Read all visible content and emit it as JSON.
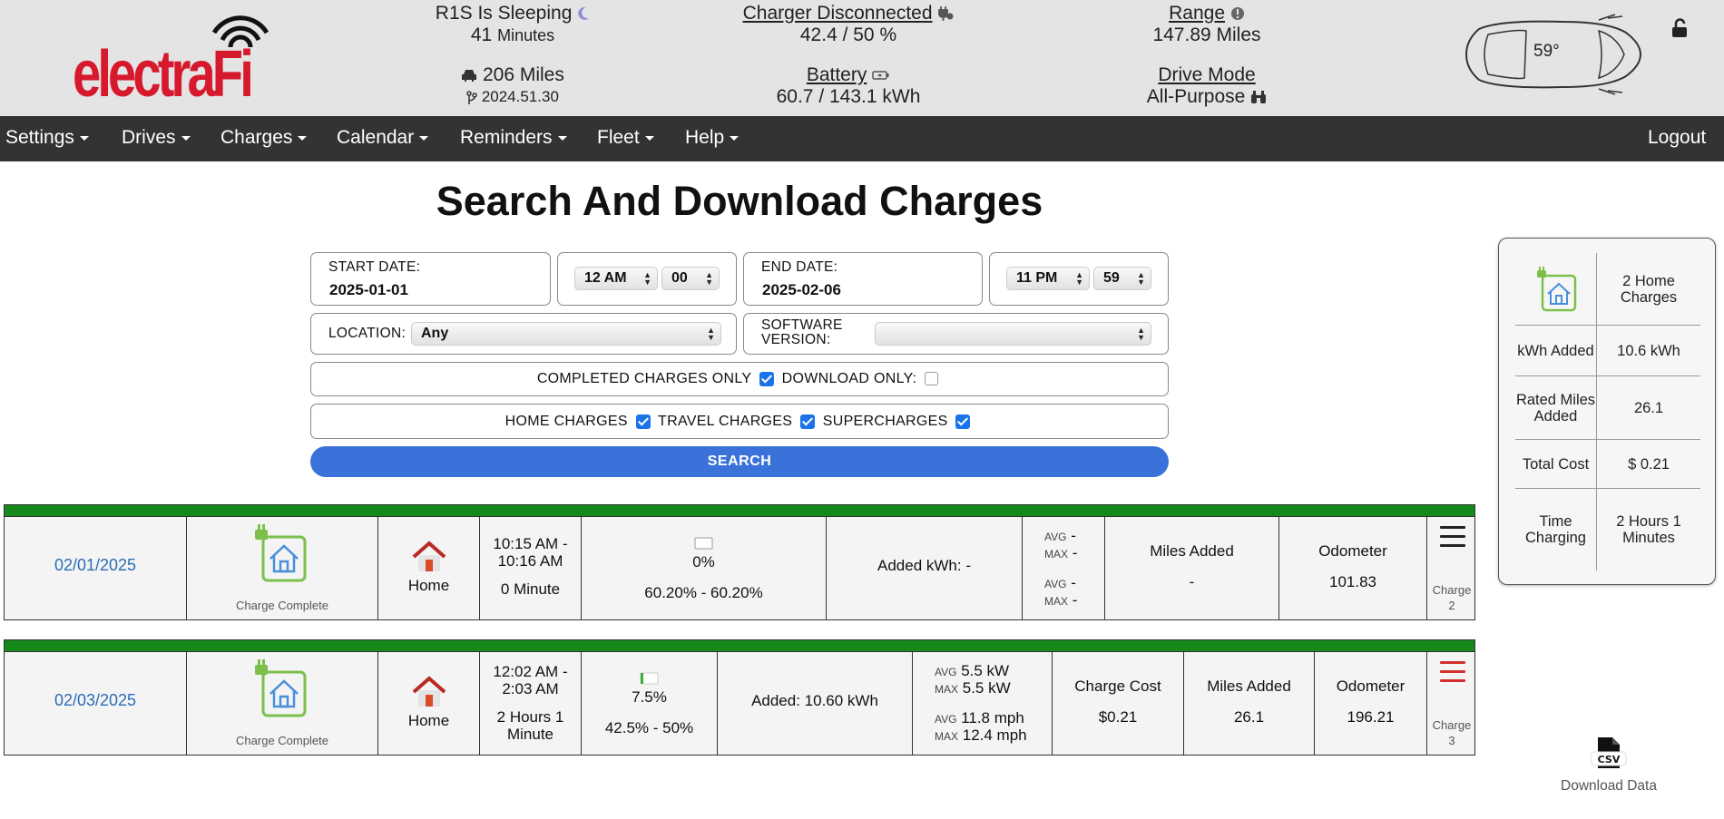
{
  "header": {
    "logo_text": "electraFi",
    "sleep_status": "R1S Is Sleeping",
    "sleep_time_value": "41",
    "sleep_time_unit": "Minutes",
    "odometer_miles": "206 Miles",
    "software_version": "2024.51.30",
    "charger_status": "Charger Disconnected",
    "charge_level": "42.4 / 50 %",
    "battery_label": "Battery",
    "battery_value": "60.7 / 143.1 kWh",
    "range_label": "Range",
    "range_value": "147.89 Miles",
    "drive_mode_label": "Drive Mode",
    "drive_mode_value": "All-Purpose",
    "temperature": "59°"
  },
  "nav": {
    "items": [
      "Settings",
      "Drives",
      "Charges",
      "Calendar",
      "Reminders",
      "Fleet",
      "Help"
    ],
    "logout": "Logout"
  },
  "page_title": "Search And Download Charges",
  "form": {
    "start_label": "START DATE:",
    "start_value": "2025-01-01",
    "start_hour": "12 AM",
    "start_minute": "00",
    "end_label": "END DATE:",
    "end_value": "2025-02-06",
    "end_hour": "11 PM",
    "end_minute": "59",
    "location_label": "LOCATION:",
    "location_value": "Any",
    "software_label_1": "SOFTWARE",
    "software_label_2": "VERSION:",
    "software_value": "",
    "completed_only_label": "COMPLETED CHARGES ONLY",
    "download_only_label": "DOWNLOAD ONLY:",
    "home_label": "HOME CHARGES",
    "travel_label": "TRAVEL CHARGES",
    "super_label": "SUPERCHARGES",
    "search_button": "SEARCH"
  },
  "summary": {
    "home_charges": "2 Home Charges",
    "kwh_label": "kWh Added",
    "kwh_value": "10.6 kWh",
    "miles_label": "Rated Miles Added",
    "miles_value": "26.1",
    "cost_label": "Total Cost",
    "cost_value": "$ 0.21",
    "time_label": "Time Charging",
    "time_value": "2 Hours 1 Minutes"
  },
  "charges": [
    {
      "date": "02/01/2025",
      "status": "Charge Complete",
      "location": "Home",
      "time_range": "10:15 AM - 10:16 AM",
      "duration": "0 Minute",
      "battery_pct": "0%",
      "soc_range": "60.20% - 60.20%",
      "added": "Added kWh: -",
      "avg_label": "AVG",
      "max_label": "MAX",
      "avg_power": "-",
      "max_power": "-",
      "avg_speed": "-",
      "max_speed": "-",
      "miles_label": "Miles Added",
      "miles_value": "-",
      "odometer_label": "Odometer",
      "odometer_value": "101.83",
      "charge_label": "Charge",
      "charge_num": "2",
      "menu_color": "#222222"
    },
    {
      "date": "02/03/2025",
      "status": "Charge Complete",
      "location": "Home",
      "time_range": "12:02 AM - 2:03 AM",
      "duration": "2 Hours 1 Minute",
      "battery_pct": "7.5%",
      "soc_range": "42.5% - 50%",
      "added": "Added: 10.60 kWh",
      "avg_label": "AVG",
      "max_label": "MAX",
      "avg_power": "5.5 kW",
      "max_power": "5.5 kW",
      "avg_speed": "11.8 mph",
      "max_speed": "12.4 mph",
      "cost_label": "Charge Cost",
      "cost_value": "$0.21",
      "miles_label": "Miles Added",
      "miles_value": "26.1",
      "odometer_label": "Odometer",
      "odometer_value": "196.21",
      "charge_label": "Charge",
      "charge_num": "3",
      "menu_color": "#d32f2f"
    }
  ],
  "download": {
    "icon_text": "CSV",
    "label": "Download Data"
  },
  "colors": {
    "brand": "#d7192d",
    "nav_bg": "#333333",
    "header_bg": "#e4e4e4",
    "search_button": "#3b72d9",
    "row_bar": "#158a1b",
    "link": "#2a6db5"
  }
}
